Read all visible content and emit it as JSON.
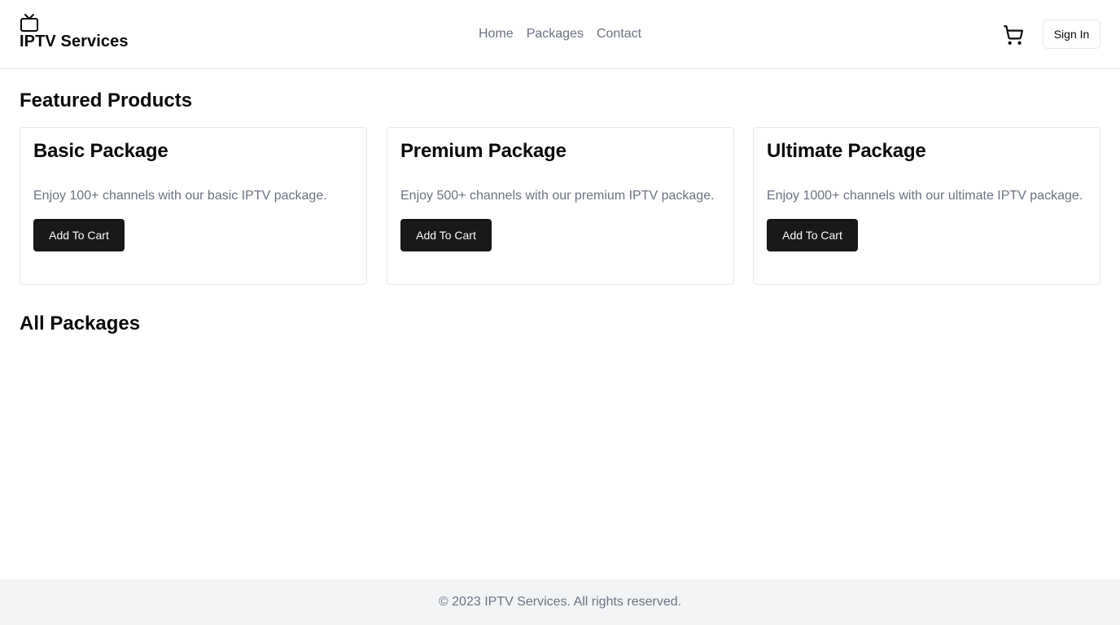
{
  "header": {
    "brand_icon": "tv-icon",
    "brand_name": "IPTV Services",
    "nav": [
      {
        "label": "Home"
      },
      {
        "label": "Packages"
      },
      {
        "label": "Contact"
      }
    ],
    "cart_icon": "cart-icon",
    "sign_in_label": "Sign In"
  },
  "featured": {
    "title": "Featured Products",
    "cards": [
      {
        "title": "Basic Package",
        "description": "Enjoy 100+ channels with our basic IPTV package.",
        "button_label": "Add To Cart"
      },
      {
        "title": "Premium Package",
        "description": "Enjoy 500+ channels with our premium IPTV package.",
        "button_label": "Add To Cart"
      },
      {
        "title": "Ultimate Package",
        "description": "Enjoy 1000+ channels with our ultimate IPTV package.",
        "button_label": "Add To Cart"
      }
    ]
  },
  "all_packages": {
    "title": "All Packages"
  },
  "footer": {
    "text": "© 2023 IPTV Services. All rights reserved."
  },
  "colors": {
    "button_bg": "#18181b",
    "muted_text": "#6b7280",
    "footer_bg": "#f3f4f6",
    "border": "#e5e7eb"
  }
}
